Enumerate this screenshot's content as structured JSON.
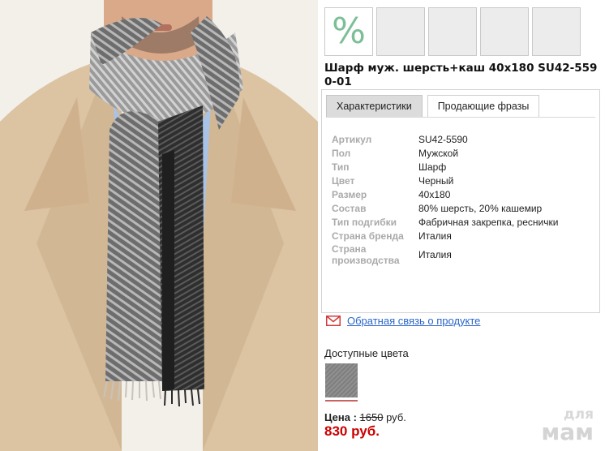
{
  "thumbnails": {
    "selected_symbol": "%",
    "items": [
      "selected",
      "empty",
      "empty",
      "empty",
      "empty"
    ]
  },
  "product": {
    "title": "Шарф муж. шерсть+каш 40x180 SU42-5590-01"
  },
  "tabs": [
    {
      "label": "Характеристики",
      "active": true
    },
    {
      "label": "Продающие фразы",
      "active": false
    }
  ],
  "specs": [
    {
      "label": "Артикул",
      "value": "SU42-5590"
    },
    {
      "label": "Пол",
      "value": "Мужской"
    },
    {
      "label": "Тип",
      "value": "Шарф"
    },
    {
      "label": "Цвет",
      "value": "Черный"
    },
    {
      "label": "Размер",
      "value": "40x180"
    },
    {
      "label": "Состав",
      "value": "80% шерсть, 20% кашемир"
    },
    {
      "label": "Тип подгибки",
      "value": "Фабричная закрепка, реснички"
    },
    {
      "label": "Страна бренда",
      "value": "Италия"
    },
    {
      "label": "Страна производства",
      "value": "Италия"
    }
  ],
  "feedback": {
    "icon": "mail-icon",
    "link": "Обратная связь о продукте"
  },
  "colors": {
    "title": "Доступные цвета",
    "swatch_color": "#868686",
    "selected_underline": "#c76363"
  },
  "price": {
    "label": "Цена :",
    "old": "1650",
    "currency": "руб.",
    "new": "830 руб."
  },
  "watermark": {
    "top": "для",
    "bottom": "мам"
  },
  "accent_colors": {
    "link": "#2b66c8",
    "sale_price": "#cc0000",
    "percent_badge": "#7cbf96"
  }
}
